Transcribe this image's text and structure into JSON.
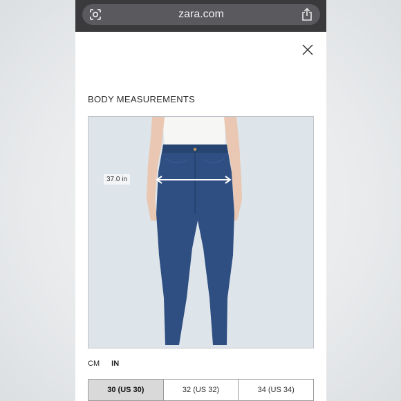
{
  "browser": {
    "url": "zara.com",
    "icons": [
      "lens-icon",
      "share-icon"
    ]
  },
  "modal": {
    "title": "BODY MEASUREMENTS",
    "close_icon": "close-icon",
    "measurement_label": "37.0 in",
    "units": [
      "CM",
      "IN"
    ],
    "active_unit": "IN",
    "sizes": [
      "30 (US 30)",
      "32 (US 32)",
      "34 (US 34)"
    ],
    "selected_size": "30 (US 30)"
  },
  "colors": {
    "browser_bar": "#3a3a3c",
    "denim": "#2f4f82",
    "selected_size_bg": "#d9d9d9"
  }
}
